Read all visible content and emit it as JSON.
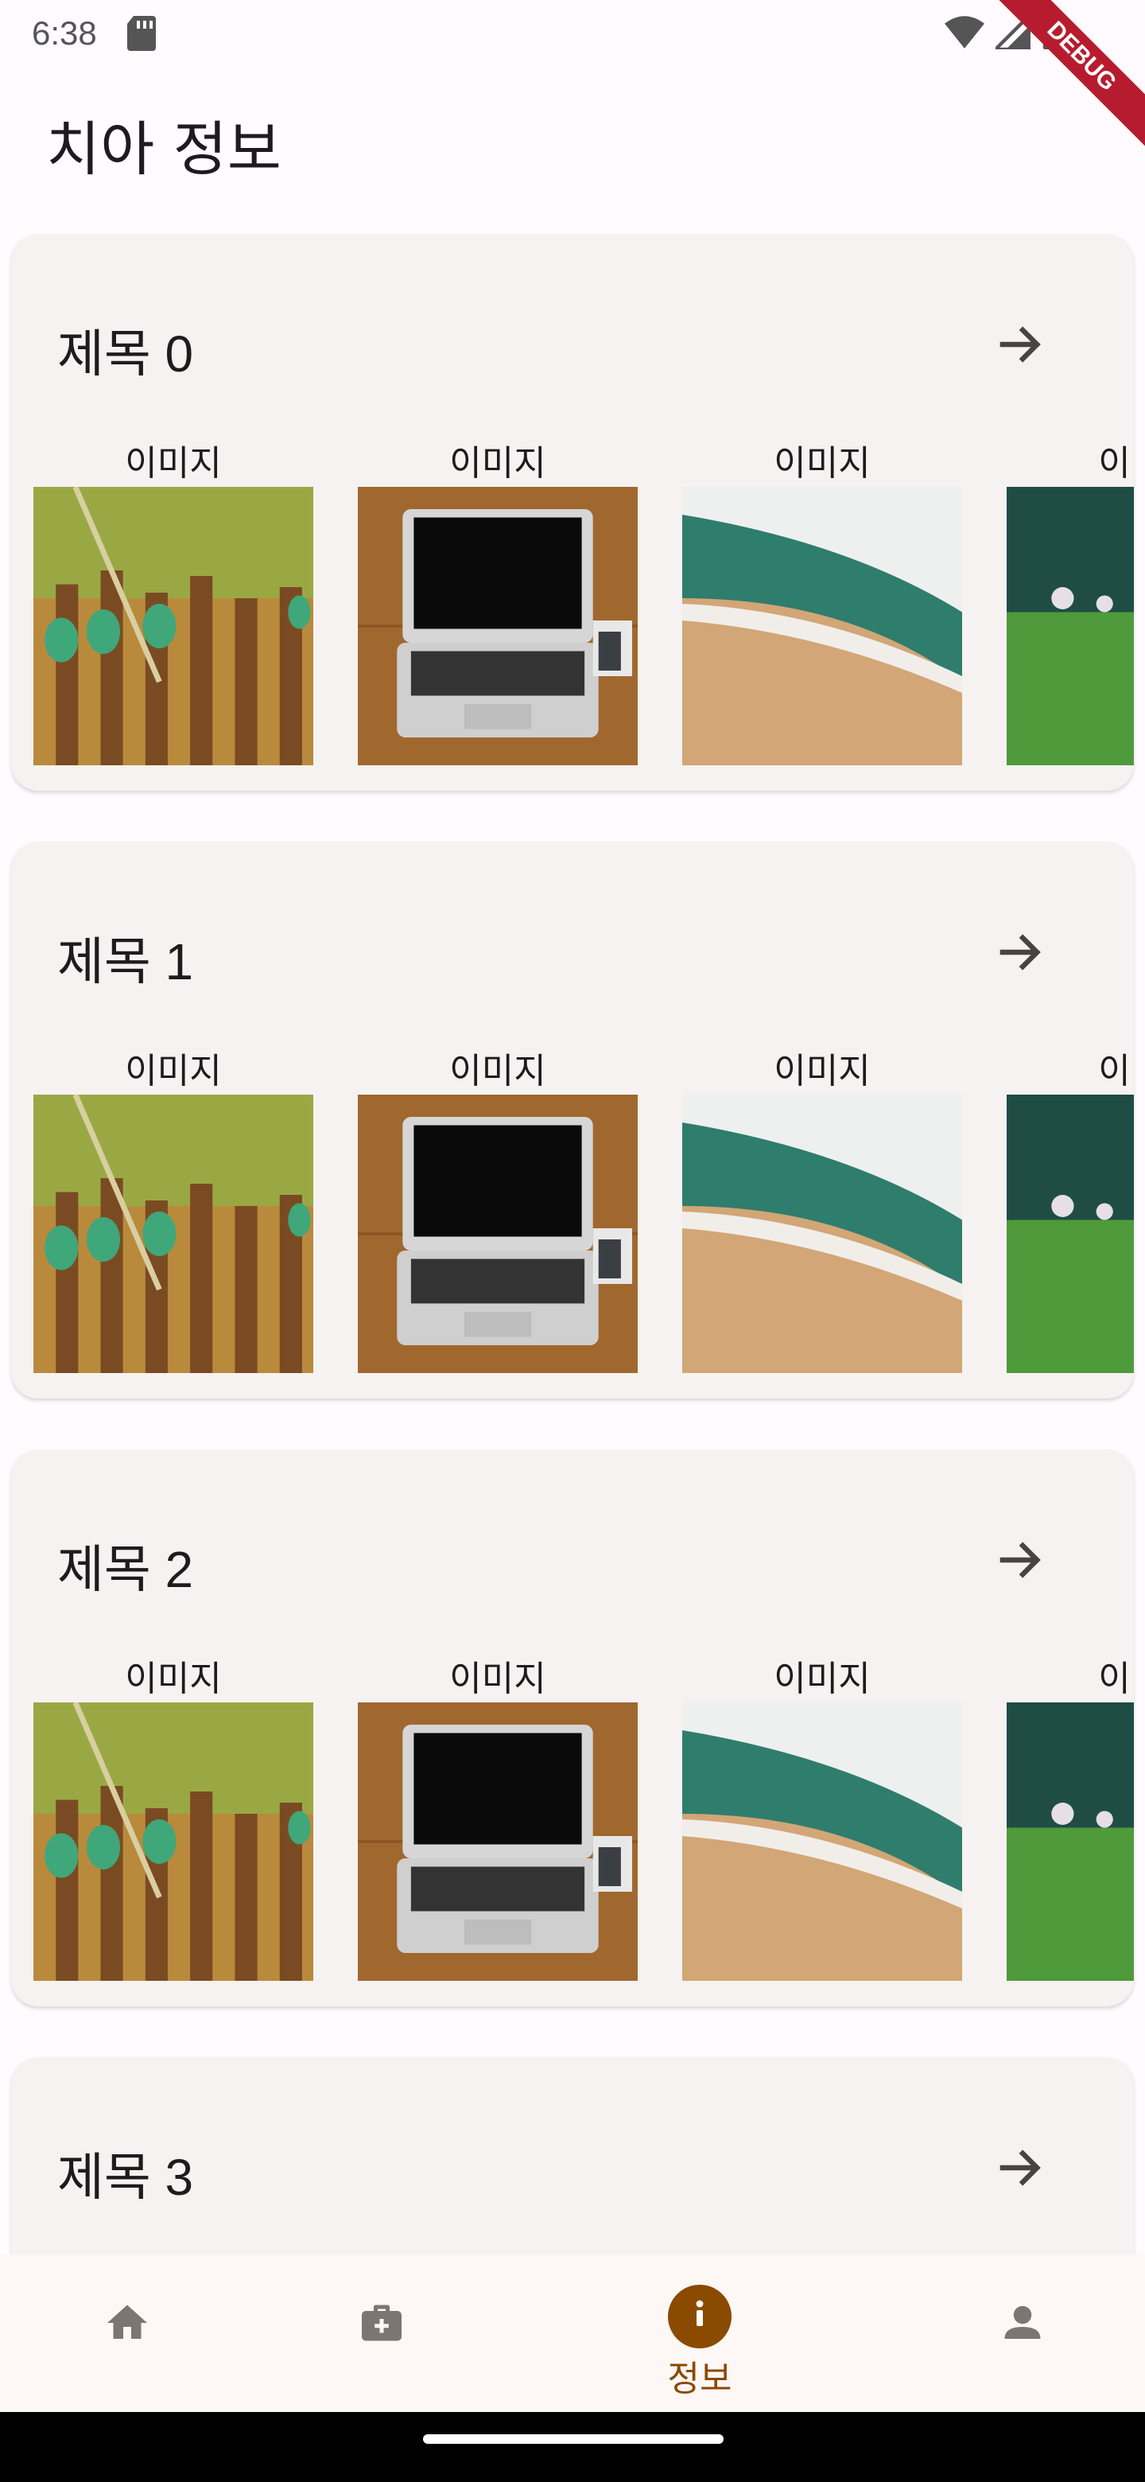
{
  "status_bar": {
    "time": "6:38",
    "debug_label": "DEBUG"
  },
  "page": {
    "title": "치아 정보"
  },
  "cards": [
    {
      "title": "제목 0",
      "images": [
        "이미지",
        "이미지",
        "이미지",
        "이미지"
      ]
    },
    {
      "title": "제목 1",
      "images": [
        "이미지",
        "이미지",
        "이미지",
        "이미지"
      ]
    },
    {
      "title": "제목 2",
      "images": [
        "이미지",
        "이미지",
        "이미지",
        "이미지"
      ]
    },
    {
      "title": "제목 3"
    }
  ],
  "bottom_nav": {
    "items": [
      {
        "icon": "home-icon",
        "label": ""
      },
      {
        "icon": "medical-bag-icon",
        "label": ""
      },
      {
        "icon": "info-icon",
        "label": "정보",
        "active": true
      },
      {
        "icon": "person-icon",
        "label": ""
      }
    ],
    "active_color": "#8a4a00",
    "inactive_color": "#7d7571"
  }
}
